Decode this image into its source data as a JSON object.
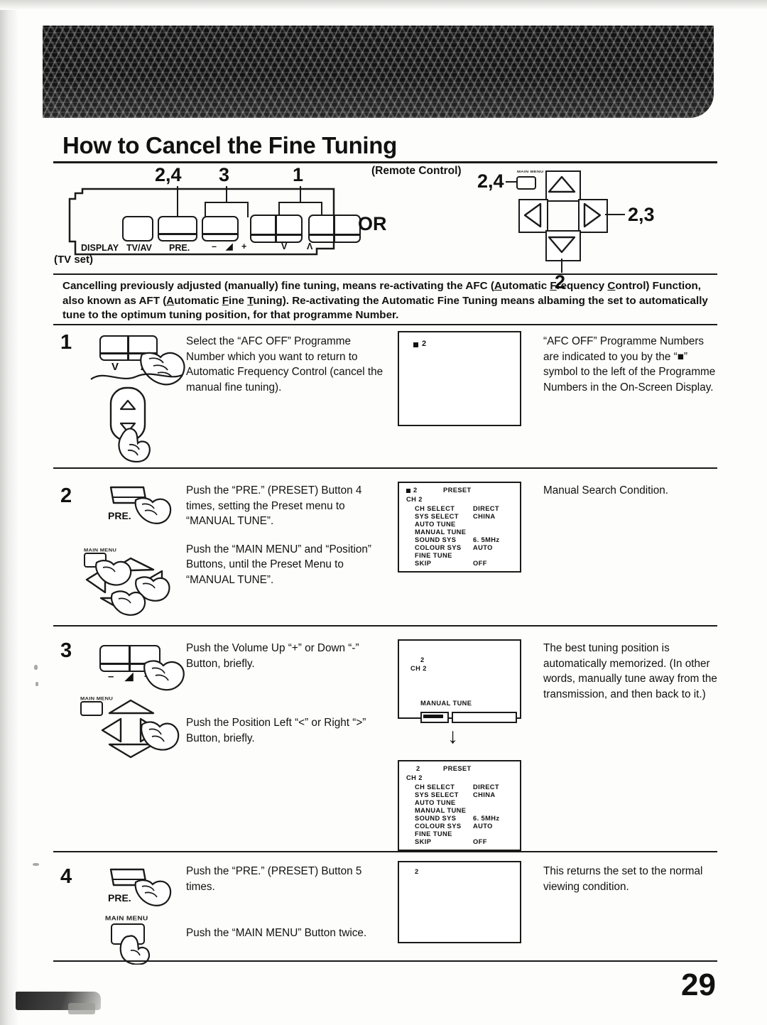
{
  "page": {
    "title": "How to Cancel the Fine Tuning",
    "page_number": "29"
  },
  "diagram": {
    "tvset_caption": "(TV set)",
    "remote_caption": "(Remote Control)",
    "or_label": "OR",
    "tvset_callouts": {
      "pre": "2,4",
      "volume": "3",
      "channel": "1"
    },
    "tvset_button_labels": {
      "display": "DISPLAY",
      "tvav": "TV/AV",
      "pre": "PRE.",
      "volume_minus": "–",
      "volume_icon": "◢",
      "volume_plus": "+",
      "channel_down": "V",
      "channel_up": "Λ"
    },
    "remote_callouts": {
      "main_menu": "2,4",
      "right": "2,3",
      "down": "2"
    },
    "remote_main_menu_label": "MAIN MENU"
  },
  "intro": {
    "line1_a": "Cancelling previously adjusted (manually) fine tuning, means re-activating the AFC (",
    "line1_u1": "A",
    "line1_b": "utomatic ",
    "line1_u2": "F",
    "line1_c": "requency",
    "line2_u1": "C",
    "line2_a": "ontrol) Function, also known as AFT (",
    "line2_u2": "A",
    "line2_b": "utomatic ",
    "line2_u3": "F",
    "line2_c": "ine ",
    "line2_u4": "T",
    "line2_d": "uning). Re-activating the Automatic Fine Tuning",
    "line3": "means albaming the set to automatically tune to the optimum tuning position, for that programme Number."
  },
  "steps": [
    {
      "number": "1",
      "instruction": "Select the “AFC OFF” Programme Number which you want to return to Automatic Frequency Control (cancel the manual fine tuning).",
      "result": "“AFC OFF” Programme Numbers are indicated to you by the “■” symbol to the left of the Programme Numbers in the On-Screen Display.",
      "art_labels": {
        "channel_down": "V",
        "channel_up": "Λ",
        "remote_up": "Λ",
        "remote_down": "V"
      },
      "osd": {
        "programme": "2",
        "has_square": true
      }
    },
    {
      "number": "2",
      "instruction_1": "Push the “PRE.” (PRESET) Button 4 times, setting the Preset menu to “MANUAL TUNE”.",
      "instruction_2": "Push the “MAIN MENU” and “Position” Buttons, until the Preset Menu to “MANUAL TUNE”.",
      "result": "Manual Search Condition.",
      "art_labels": {
        "pre": "PRE.",
        "main_menu": "MAIN MENU"
      },
      "osd": {
        "has_square": true,
        "programme": "2",
        "heading": "PRESET",
        "channel": "CH 2",
        "rows": [
          {
            "label": "CH  SELECT",
            "value": "DIRECT"
          },
          {
            "label": "SYS  SELECT",
            "value": "CHINA"
          },
          {
            "label": "AUTO  TUNE",
            "value": ""
          },
          {
            "label": "MANUAL TUNE",
            "value": ""
          },
          {
            "label": "SOUND  SYS",
            "value": "6. 5MHz"
          },
          {
            "label": "COLOUR SYS",
            "value": "AUTO"
          },
          {
            "label": "FINE TUNE",
            "value": ""
          },
          {
            "label": "SKIP",
            "value": "OFF"
          }
        ]
      }
    },
    {
      "number": "3",
      "instruction_1": "Push the Volume Up “+” or Down “-” Button, briefly.",
      "instruction_2": "Push the Position Left “<” or Right “>” Button, briefly.",
      "result": "The best tuning position is automatically memorized. (In other words, manually tune away from the transmission, and then back to it.)",
      "art_labels": {
        "volume_minus": "–",
        "volume_icon": "◢",
        "volume_plus": "+",
        "main_menu": "MAIN MENU"
      },
      "osd_tune": {
        "programme": "2",
        "channel": "CH 2",
        "mode": "MANUAL TUNE"
      },
      "osd_preset": {
        "has_square": false,
        "programme": "2",
        "heading": "PRESET",
        "channel": "CH 2",
        "rows": [
          {
            "label": "CH  SELECT",
            "value": "DIRECT"
          },
          {
            "label": "SYS  SELECT",
            "value": "CHINA"
          },
          {
            "label": "AUTO  TUNE",
            "value": ""
          },
          {
            "label": "MANUAL TUNE",
            "value": ""
          },
          {
            "label": "SOUND  SYS",
            "value": "6. 5MHz"
          },
          {
            "label": "COLOUR SYS",
            "value": "AUTO"
          },
          {
            "label": "FINE TUNE",
            "value": ""
          },
          {
            "label": "SKIP",
            "value": "OFF"
          }
        ]
      }
    },
    {
      "number": "4",
      "instruction_1": "Push the “PRE.” (PRESET) Button 5 times.",
      "instruction_2": "Push the “MAIN MENU” Button twice.",
      "result": "This returns the set to the normal viewing condition.",
      "art_labels": {
        "pre": "PRE.",
        "main_menu": "MAIN MENU"
      },
      "osd": {
        "programme": "2",
        "has_square": false
      }
    }
  ]
}
